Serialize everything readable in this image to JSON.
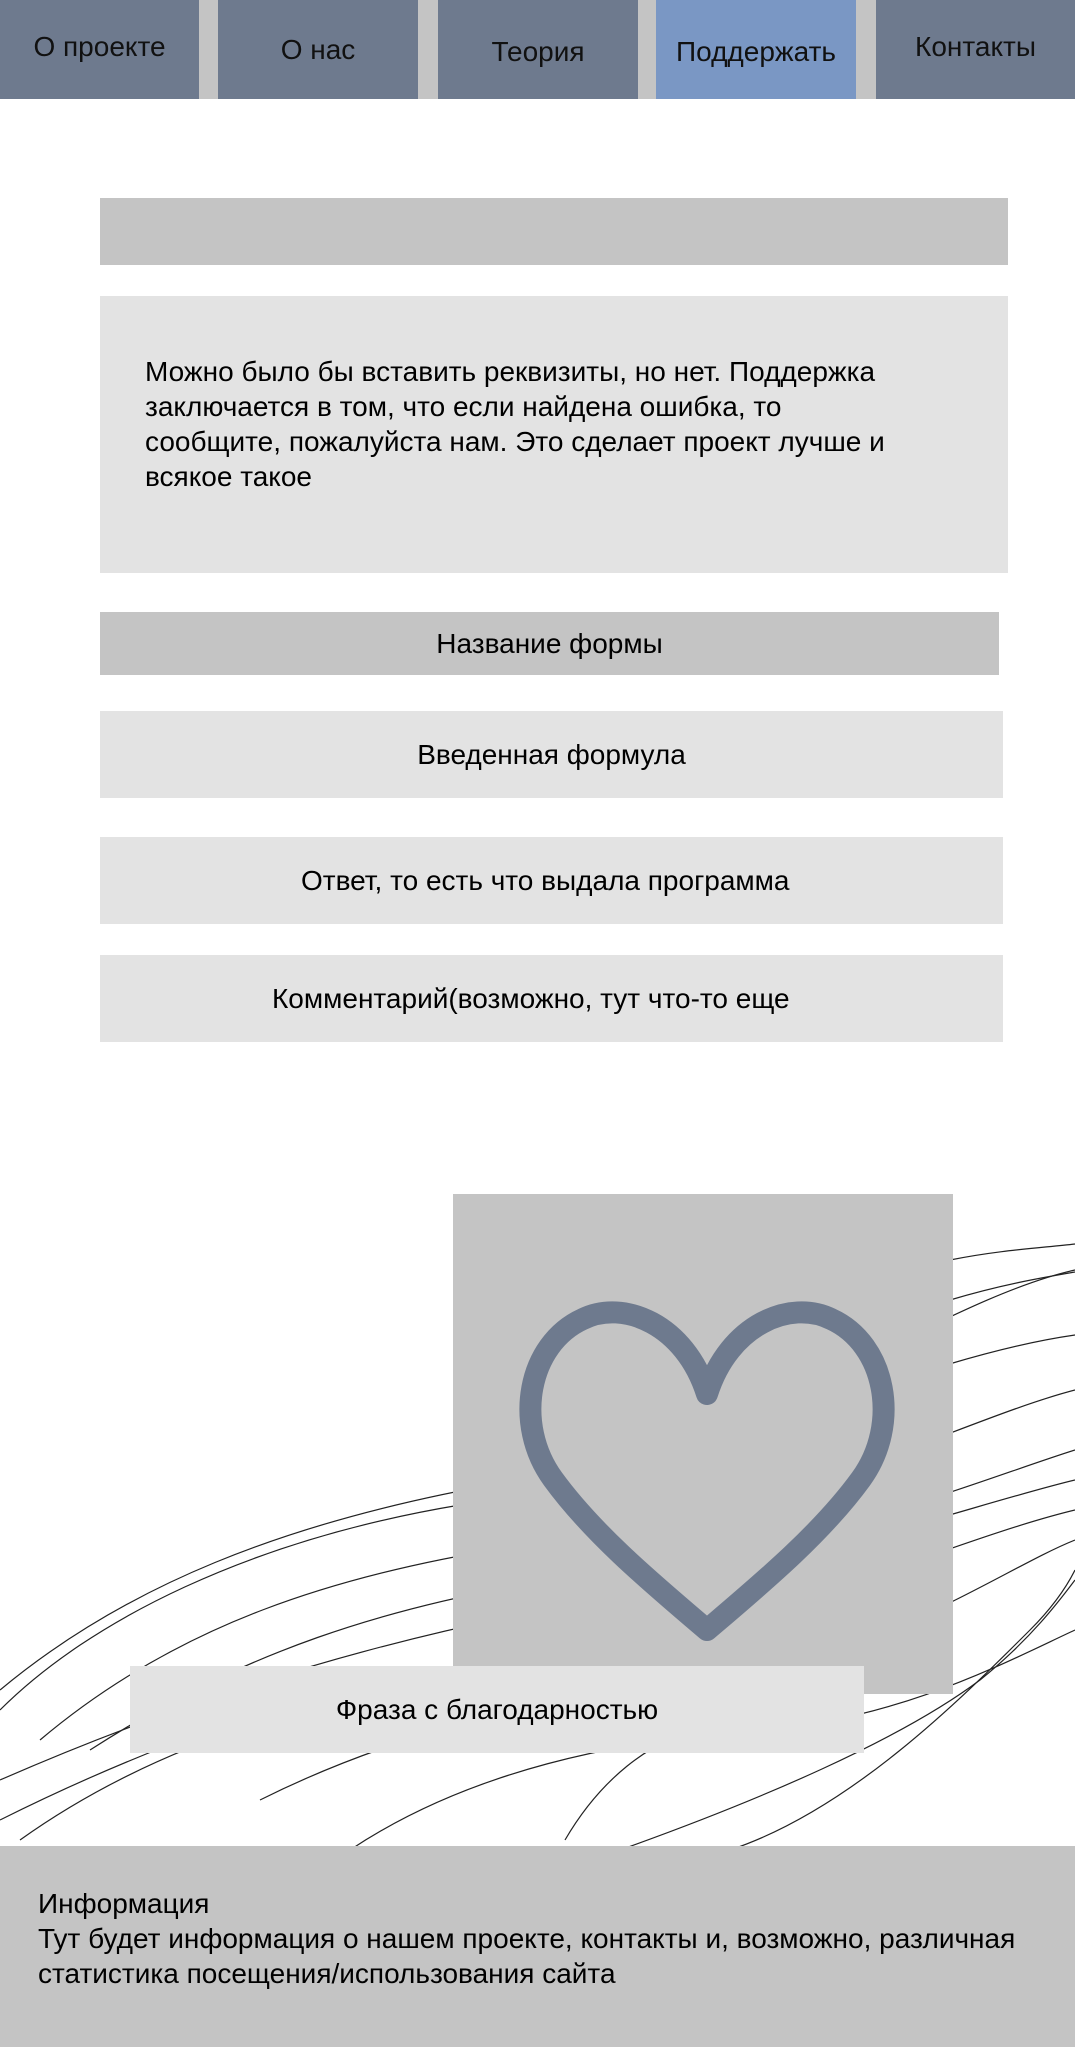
{
  "nav": {
    "tabs": [
      {
        "label": "О проекте"
      },
      {
        "label": "О нас"
      },
      {
        "label": "Теория"
      },
      {
        "label": "Поддержать"
      },
      {
        "label": "Контакты"
      }
    ],
    "active_tab": "Поддержать",
    "tab_color": "#6e7a8e",
    "active_tab_color": "#7a97c4"
  },
  "main": {
    "support_text": "Можно было бы вставить реквизиты, но нет. Поддержка заключается в том, что если найдена ошибка, то сообщите, пожалуйста нам. Это сделает проект лучше и всякое такое"
  },
  "form": {
    "title": "Название формы",
    "fields": [
      {
        "label": "Введенная формула"
      },
      {
        "label": "Ответ, то есть что выдала программа"
      },
      {
        "label": "Комментарий(возможно, тут что-то еще"
      }
    ]
  },
  "thanks": {
    "icon": "heart-icon",
    "heart_color": "#6e7a8e",
    "phrase": "Фраза с благодарностью"
  },
  "footer": {
    "title": "Информация",
    "text": "Тут будет информация о нашем проекте, контакты и, возможно, различная статистика посещения/использования сайта"
  }
}
